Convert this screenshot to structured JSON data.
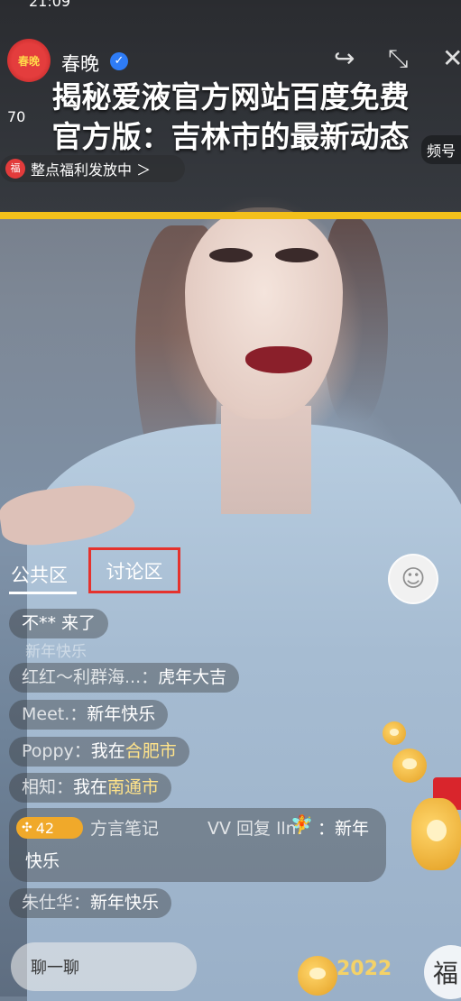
{
  "status": {
    "time": "21:09"
  },
  "headline": {
    "line1": "揭秘爱液官方网站百度免费",
    "line2": "官方版：吉林市的最新动态"
  },
  "header": {
    "host_name": "春晚",
    "avatar_text": "春晚",
    "viewers": "70",
    "live_pill": "频号",
    "welfare_icon": "福",
    "welfare_text": "整点福利发放中 ＞"
  },
  "tabs": {
    "public": "公共区",
    "discussion": "讨论区"
  },
  "chat": {
    "faded": "新年快乐",
    "messages": [
      {
        "text": "不** 来了"
      },
      {
        "who": "红红～利群海...：",
        "text": "虎年大吉"
      },
      {
        "who": "Meet.：",
        "text": "新年快乐"
      },
      {
        "who": "Poppy：",
        "text": "我在",
        "highlight": "合肥市"
      },
      {
        "who": "相知：",
        "text": "我在",
        "highlight": "南通市"
      },
      {
        "who": "朱仕华：",
        "text": "新年快乐"
      }
    ],
    "multi": {
      "badge": "42",
      "who": "方言笔记",
      "reply": "ᐯᐯ 回复 llm",
      "text_line1": "：新年",
      "text_line2": "快乐"
    }
  },
  "bottom": {
    "input_placeholder": "聊一聊",
    "fu_label": "福",
    "year": "2022"
  },
  "icons": {
    "verified": "check-icon",
    "share": "share-icon",
    "shrink": "shrink-icon",
    "close": "close-icon",
    "badge": "star-icon",
    "fairy": "fairy-icon"
  },
  "colors": {
    "accent_yellow": "#f3c01b",
    "highlight_red": "#e5322d",
    "badge_orange": "#f0a92a"
  }
}
